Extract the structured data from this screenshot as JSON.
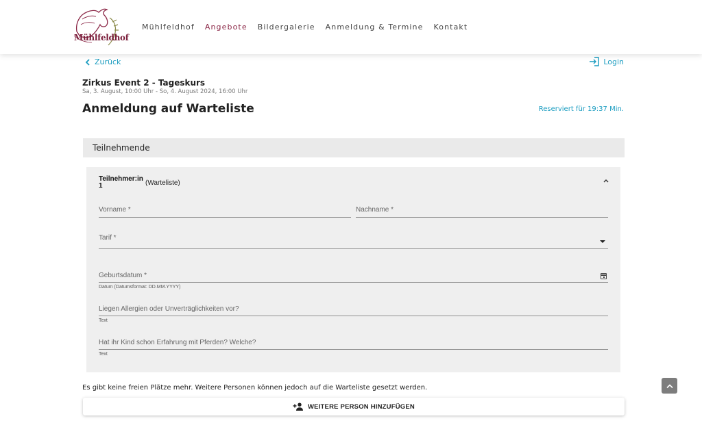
{
  "header": {
    "logo_text": "Mühlfeldhof",
    "nav": [
      {
        "label": "Mühlfeldhof",
        "active": false
      },
      {
        "label": "Angebote",
        "active": true
      },
      {
        "label": "Bildergalerie",
        "active": false
      },
      {
        "label": "Anmeldung & Termine",
        "active": false
      },
      {
        "label": "Kontakt",
        "active": false
      }
    ]
  },
  "toolbar": {
    "back_label": "Zurück",
    "login_label": "Login"
  },
  "event": {
    "title": "Zirkus Event 2 - Tageskurs",
    "date": "Sa, 3. August, 10:00 Uhr - So, 4. August 2024, 16:00 Uhr"
  },
  "page": {
    "title": "Anmeldung auf Warteliste",
    "reserved": "Reserviert für 19:37 Min."
  },
  "section": {
    "title": "Teilnehmende"
  },
  "participant": {
    "heading_line1": "Teilnehmer:in",
    "heading_line2": "1",
    "status": "(Warteliste)",
    "fields": {
      "vorname": {
        "label": "Vorname *",
        "value": ""
      },
      "nachname": {
        "label": "Nachname *",
        "value": ""
      },
      "tarif": {
        "label": "Tarif *",
        "value": ""
      },
      "geburtsdatum": {
        "label": "Geburtsdatum *",
        "hint": "Datum (Datumsformat: DD.MM.YYYY)",
        "value": ""
      },
      "allergien": {
        "label": "Liegen Allergien oder Unverträglichkeiten vor?",
        "hint": "Text",
        "value": ""
      },
      "erfahrung": {
        "label": "Hat ihr Kind schon Erfahrung mit Pferden? Welche?",
        "hint": "Text",
        "value": ""
      }
    }
  },
  "notice": "Es gibt keine freien Plätze mehr. Weitere Personen können jedoch auf die Warteliste gesetzt werden.",
  "add_button": "WEITERE PERSON HINZUFÜGEN",
  "colors": {
    "accent": "#1a9cc0",
    "brand": "#8a2545",
    "panel": "#efefef"
  },
  "icons": {
    "back": "chevron-left-icon",
    "login": "login-arrow-icon",
    "collapse": "chevron-up-icon",
    "dropdown": "caret-down-icon",
    "calendar": "calendar-icon",
    "add_person": "person-add-icon",
    "scroll_top": "chevron-up-icon"
  }
}
